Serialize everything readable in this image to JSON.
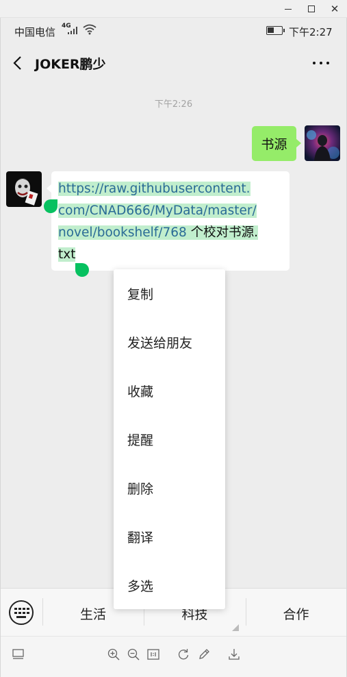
{
  "status_bar": {
    "carrier": "中国电信",
    "network_type": "4G",
    "time": "下午2:27"
  },
  "header": {
    "title": "JOKER鹏少",
    "back_icon": "chevron-left-icon",
    "more_icon": "more-dots-icon"
  },
  "chat": {
    "timestamp": "下午2:26",
    "sent_message": "书源",
    "received_message": {
      "line1": "https://raw.githubusercontent.",
      "line2": "com/CNAD666/MyData/master/",
      "line3_link": "novel/bookshelf/768",
      "line3_text": " 个校对书源.",
      "line4": "txt"
    }
  },
  "context_menu": {
    "items": [
      "复制",
      "发送给朋友",
      "收藏",
      "提醒",
      "删除",
      "翻译",
      "多选"
    ]
  },
  "bottom_menu": {
    "tabs": [
      "生活",
      "科技",
      "合作"
    ]
  },
  "colors": {
    "sent_bubble": "#95ec69",
    "selection_highlight": "#c1eecd",
    "selection_handle": "#07c160",
    "link_text": "#2a6b96"
  }
}
